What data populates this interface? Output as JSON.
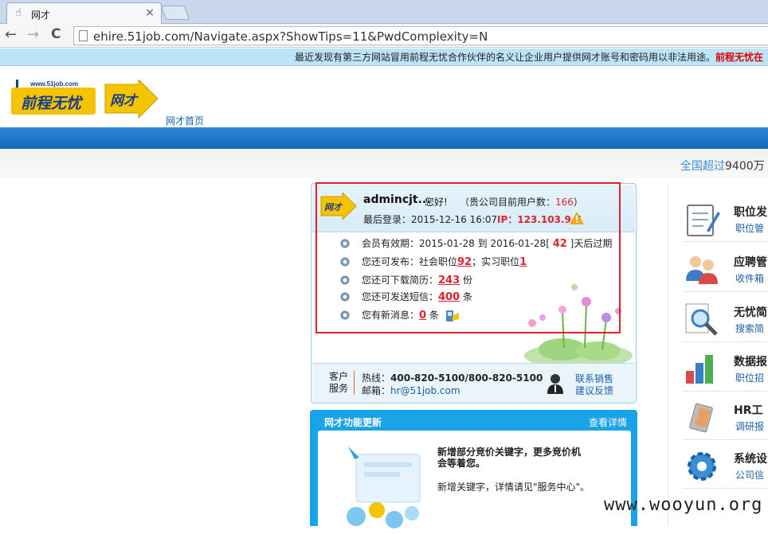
{
  "browser": {
    "tab_title": "网才",
    "tab_close": "×",
    "url": "ehire.51job.com/Navigate.aspx?ShowTips=11&PwdComplexity=N",
    "back": "←",
    "forward": "→",
    "reload": "C"
  },
  "notice": {
    "text": "最近发现有第三方网站冒用前程无忧合作伙伴的名义让企业用户提供网才账号和密码用以非法用途。",
    "highlight": "前程无忧在"
  },
  "header": {
    "logo_url_text": "www.51job.com",
    "logo_main": "前程无忧",
    "logo_secondary": "网才",
    "home_link": "网才首页",
    "stats_prefix": "全国超过",
    "stats_number": "9400万"
  },
  "account": {
    "logo_text": "网才",
    "username": "admincjt...",
    "greeting": "您好!",
    "user_count_label": "（贵公司目前用户数：",
    "user_count_value": "166",
    "user_count_suffix": "）",
    "last_login_label": "最后登录：",
    "last_login_value": "2015-12-16 16:07",
    "ip_label": "IP：",
    "ip_value": "123.103.9.7",
    "membership": {
      "label": "会员有效期：",
      "start": "2015-01-28",
      "to": "到",
      "end": "2016-01-28",
      "bracket_open": "[",
      "days": "42",
      "bracket_close": "]",
      "suffix": "天后过期"
    },
    "publish": {
      "label": "您还可发布：社会职位",
      "social": "92",
      "sep": "；实习职位",
      "intern": "1"
    },
    "download": {
      "label": "您还可下载简历：",
      "value": "243",
      "unit": "份"
    },
    "sms": {
      "label": "您还可发送短信：",
      "value": "400",
      "unit": "条"
    },
    "messages": {
      "label": "您有新消息：",
      "value": "0",
      "unit": "条"
    },
    "service": {
      "label_line1": "客户",
      "label_line2": "服务",
      "hotline_label": "热线：",
      "hotline": "400-820-5100/800-820-5100",
      "email_label": "邮箱：",
      "email": "hr@51job.com",
      "contact_sales": "联系销售",
      "feedback": "建议反馈"
    }
  },
  "updates": {
    "title": "网才功能更新",
    "more": "查看详情",
    "headline": "新增部分竞价关键字，更多竞价机会等着您。",
    "desc": "新增关键字，详情请见\"服务中心\"。"
  },
  "right_menu": [
    {
      "name": "职位发",
      "sub": "职位管",
      "icon": "notepad-icon"
    },
    {
      "name": "应聘管",
      "sub": "收件箱",
      "icon": "people-icon"
    },
    {
      "name": "无忧简",
      "sub": "搜索简",
      "icon": "magnifier-icon"
    },
    {
      "name": "数据报",
      "sub": "职位招",
      "icon": "bar-chart-icon"
    },
    {
      "name": "HR工",
      "sub": "调研报",
      "icon": "tools-icon"
    },
    {
      "name": "系统设",
      "sub": "公司信",
      "icon": "gear-icon"
    }
  ],
  "watermark": "www.wooyun.org",
  "colors": {
    "accent_blue": "#1366b8",
    "notice_bg": "#bde3f7",
    "alert_red": "#e0222a",
    "link_blue": "#1a5fa8"
  }
}
